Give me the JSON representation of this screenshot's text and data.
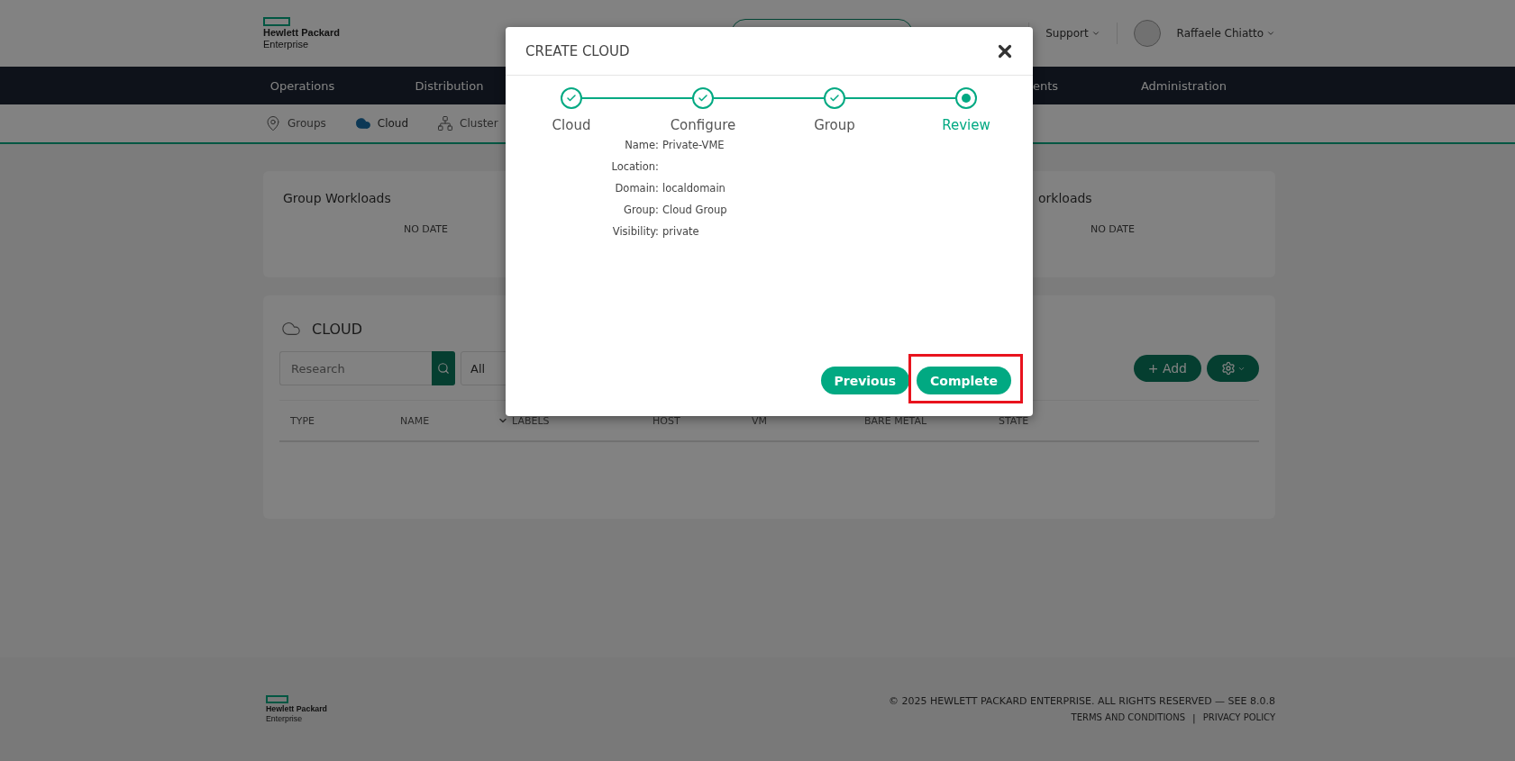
{
  "header": {
    "logo": [
      "Hewlett Packard",
      "Enterprise"
    ],
    "support": "Support",
    "user": "Raffaele Chiatto"
  },
  "nav": [
    {
      "label": "Operations"
    },
    {
      "label": "Distribution"
    }
  ],
  "nav_right": [
    {
      "label": "ents"
    },
    {
      "label": "Administration"
    }
  ],
  "subnav": [
    {
      "label": "Groups",
      "kind": "groups",
      "selected": false
    },
    {
      "label": "Cloud",
      "kind": "cloud",
      "selected": true
    },
    {
      "label": "Cluster",
      "kind": "cluster",
      "selected": false
    }
  ],
  "cards": [
    {
      "title": "Group Workloads",
      "value": "NO DATE"
    },
    {
      "title": "orkloads",
      "value": "NO DATE"
    }
  ],
  "cloud_panel": {
    "title": "CLOUD",
    "search": {
      "placeholder": "Research"
    },
    "filter": "All",
    "add": "+ Add",
    "columns": [
      {
        "label": "TYPE",
        "sorted": false
      },
      {
        "label": "NAME",
        "sorted": false
      },
      {
        "label": "LABELS",
        "sorted": true
      },
      {
        "label": "HOST",
        "sorted": false
      },
      {
        "label": "VM",
        "sorted": false
      },
      {
        "label": "BARE METAL",
        "sorted": false
      },
      {
        "label": "STATE",
        "sorted": false
      }
    ]
  },
  "footer": {
    "logo": [
      "Hewlett Packard",
      "Enterprise"
    ],
    "copyright": "© 2025 HEWLETT PACKARD ENTERPRISE. ALL RIGHTS RESERVED — SEE 8.0.8",
    "links": [
      "TERMS AND CONDITIONS",
      "PRIVACY POLICY"
    ],
    "separator": "|"
  },
  "modal": {
    "title": "CREATE CLOUD",
    "steps": [
      {
        "label": "Cloud",
        "completed": true,
        "selected": false
      },
      {
        "label": "Configure",
        "completed": true,
        "selected": false
      },
      {
        "label": "Group",
        "completed": true,
        "selected": false
      },
      {
        "label": "Review",
        "completed": false,
        "selected": true
      }
    ],
    "review": [
      {
        "label": "Name:",
        "value": "Private-VME"
      },
      {
        "label": "Location:"
      },
      {
        "label": "Domain:",
        "value": "localdomain"
      },
      {
        "label": "Group:",
        "value": "Cloud Group"
      },
      {
        "label": "Visibility:",
        "value": "private"
      }
    ],
    "buttons": [
      {
        "label": "Previous",
        "highlighted": false
      },
      {
        "label": "Complete",
        "highlighted": true
      }
    ]
  }
}
